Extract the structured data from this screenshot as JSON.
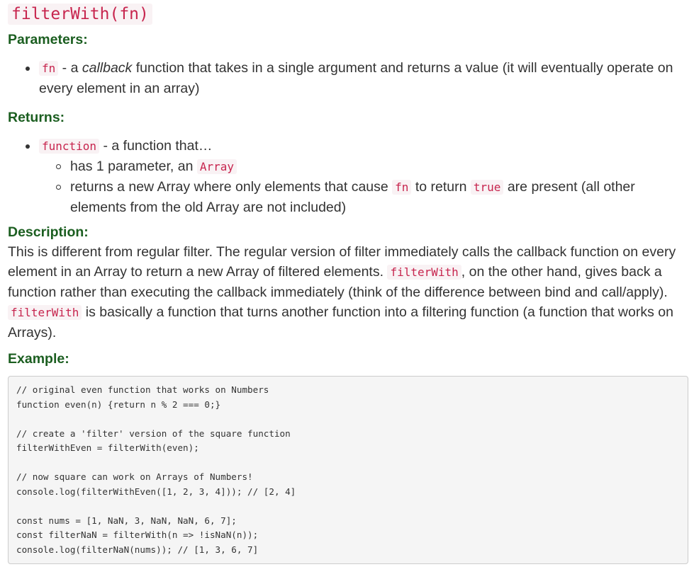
{
  "title": "filterWith(fn)",
  "parameters": {
    "heading": "Parameters:",
    "items": [
      {
        "code": "fn",
        "dash": " - a ",
        "em": "callback",
        "text": " function that takes in a single argument and returns a value (it will eventually operate on every element in an array)"
      }
    ]
  },
  "returns": {
    "heading": "Returns:",
    "item": {
      "code": "function",
      "text": " - a function that…"
    },
    "subitems": [
      {
        "text": "has 1 parameter, an ",
        "code": "Array"
      },
      {
        "text1": "returns a new Array where only elements that cause ",
        "code1": "fn",
        "text2": " to return ",
        "code2": "true",
        "text3": " are present (all other elements from the old Array are not included)"
      }
    ]
  },
  "description": {
    "heading": "Description:",
    "part1": "This is different from regular filter. The regular version of filter immediately calls the callback function on every element in an Array to return a new Array of filtered elements. ",
    "code1": "filterWith",
    "part2": ", on the other hand, gives back a function rather than executing the callback immediately (think of the difference between bind and call/apply). ",
    "code2": "filterWith",
    "part3": " is basically a function that turns another function into a filtering function (a function that works on Arrays)."
  },
  "example": {
    "heading": "Example:",
    "code": "// original even function that works on Numbers\nfunction even(n) {return n % 2 === 0;}\n\n// create a 'filter' version of the square function\nfilterWithEven = filterWith(even);\n\n// now square can work on Arrays of Numbers!\nconsole.log(filterWithEven([1, 2, 3, 4])); // [2, 4]\n\nconst nums = [1, NaN, 3, NaN, NaN, 6, 7];\nconst filterNaN = filterWith(n => !isNaN(n));\nconsole.log(filterNaN(nums)); // [1, 3, 6, 7]"
  }
}
